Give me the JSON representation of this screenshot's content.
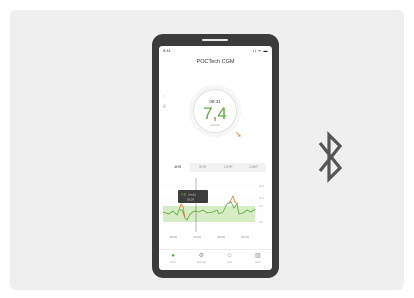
{
  "status_bar": {
    "time": "9:41",
    "icons": ".ıl ᯤ ▬"
  },
  "app": {
    "title": "POCTech CGM"
  },
  "dial": {
    "time": "09:41",
    "value": "7,4",
    "unit": "mmol/L",
    "trend_icon": "arrow-down-right-icon",
    "value_color": "#5aa83a",
    "trend_color": "#e07a2a"
  },
  "tabs": [
    {
      "label": "4HR",
      "active": true
    },
    {
      "label": "8HR",
      "active": false
    },
    {
      "label": "12HR",
      "active": false
    },
    {
      "label": "24HR",
      "active": false
    }
  ],
  "chart": {
    "tooltip_value": "7,6",
    "tooltip_unit": "mmol/L",
    "tooltip_time": "03:24",
    "y_ticks": [
      "18.0",
      "10.0",
      "7.0",
      "3.9"
    ],
    "x_ticks": [
      "18:00",
      "20:00",
      "04:00",
      "06:00"
    ],
    "target_band_color": "#d6ecc4",
    "in_range_color": "#5aa83a",
    "high_color": "#e07a2a"
  },
  "nav": [
    {
      "label": "Home",
      "icon": "drop-icon",
      "active": true
    },
    {
      "label": "Settings",
      "icon": "gear-icon",
      "active": false
    },
    {
      "label": "User",
      "icon": "user-icon",
      "active": false
    },
    {
      "label": "Data",
      "icon": "bar-chart-icon",
      "active": false
    }
  ],
  "bluetooth_icon": "bluetooth-icon"
}
